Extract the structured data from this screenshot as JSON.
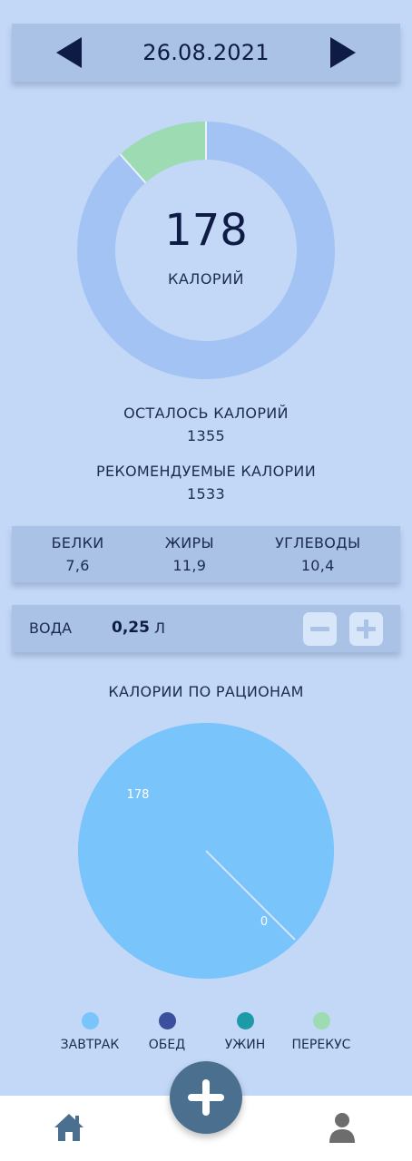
{
  "header": {
    "date": "26.08.2021",
    "prev_icon": "triangle-left-icon",
    "next_icon": "triangle-right-icon"
  },
  "calories": {
    "value": "178",
    "unit": "КАЛОРИЙ",
    "consumed_fraction": 0.116,
    "colors": {
      "consumed": "#9ddbb3",
      "remaining": "#a2c3f3",
      "inner": "#c3d8f7"
    }
  },
  "remaining": {
    "label": "ОСТАЛОСЬ КАЛОРИЙ",
    "value": "1355"
  },
  "recommended": {
    "label": "РЕКОМЕНДУЕМЫЕ КАЛОРИИ",
    "value": "1533"
  },
  "macros": [
    {
      "label": "БЕЛКИ",
      "value": "7,6"
    },
    {
      "label": "ЖИРЫ",
      "value": "11,9"
    },
    {
      "label": "УГЛЕВОДЫ",
      "value": "10,4"
    }
  ],
  "water": {
    "label": "ВОДА",
    "value": "0,25",
    "unit": "Л",
    "minus_icon": "minus-icon",
    "plus_icon": "plus-icon"
  },
  "meals_chart": {
    "title": "КАЛОРИИ ПО РАЦИОНАМ",
    "labels": {
      "breakfast": "178",
      "other": "0"
    }
  },
  "chart_data": {
    "type": "pie",
    "title": "КАЛОРИИ ПО РАЦИОНАМ",
    "categories": [
      "ЗАВТРАК",
      "ОБЕД",
      "УЖИН",
      "ПЕРЕКУС"
    ],
    "values": [
      178,
      0,
      0,
      0
    ],
    "colors": [
      "#78c4fb",
      "#3a4f9e",
      "#1c9aa8",
      "#9ddbb3"
    ],
    "legend_position": "bottom"
  },
  "legend": [
    {
      "label": "ЗАВТРАК",
      "color": "#78c4fb"
    },
    {
      "label": "ОБЕД",
      "color": "#3a4f9e"
    },
    {
      "label": "УЖИН",
      "color": "#1c9aa8"
    },
    {
      "label": "ПЕРЕКУС",
      "color": "#9ddbb3"
    }
  ],
  "nav": {
    "home_icon": "home-icon",
    "add_icon": "plus-icon",
    "profile_icon": "user-icon"
  }
}
